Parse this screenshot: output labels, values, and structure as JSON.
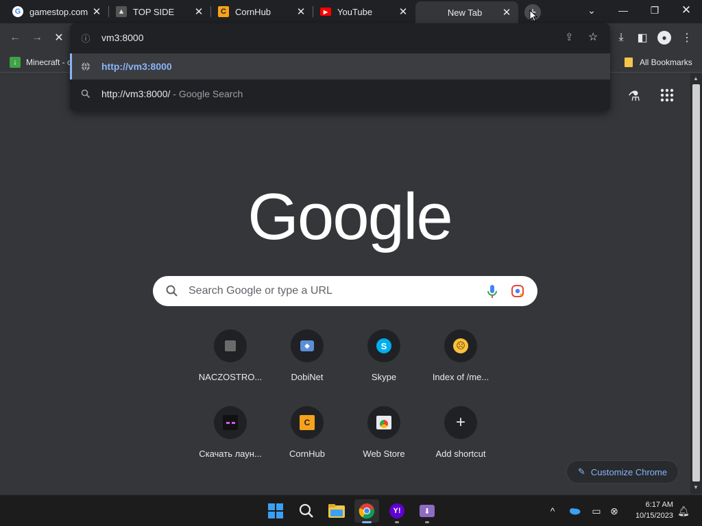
{
  "tabs": [
    {
      "title": "gamestop.com",
      "favicon": "google-g-icon"
    },
    {
      "title": "TOP SIDE",
      "favicon": "topside-icon"
    },
    {
      "title": "CornHub",
      "favicon": "cornhub-ch-icon"
    },
    {
      "title": "YouTube",
      "favicon": "youtube-icon"
    },
    {
      "title": "New Tab",
      "favicon": ""
    }
  ],
  "newtab_label": "+",
  "omnibox": {
    "value": "vm3:8000",
    "suggestions": [
      {
        "url": "http://vm3:8000",
        "icon": "globe-icon"
      },
      {
        "text": "http://vm3:8000/",
        "suffix": " - Google Search",
        "icon": "search-icon"
      }
    ]
  },
  "bookmarks": {
    "first": "Minecraft - c",
    "all": "All Bookmarks"
  },
  "logo": "Google",
  "search": {
    "placeholder": "Search Google or type a URL"
  },
  "shortcuts": [
    {
      "label": "NACZOSTRO...",
      "icon": "naczostro-icon"
    },
    {
      "label": "DobiNet",
      "icon": "dobinet-icon"
    },
    {
      "label": "Skype",
      "icon": "skype-icon"
    },
    {
      "label": "Index of /me...",
      "icon": "emoji-icon"
    },
    {
      "label": "Скачать лаун...",
      "icon": "enderman-icon"
    },
    {
      "label": "CornHub",
      "icon": "cornhub-ch-icon"
    },
    {
      "label": "Web Store",
      "icon": "webstore-icon"
    },
    {
      "label": "Add shortcut",
      "icon": "plus-icon"
    }
  ],
  "customize": "Customize Chrome",
  "clock": {
    "time": "6:17 AM",
    "date": "10/15/2023"
  },
  "colors": {
    "accent": "#8ab4f8",
    "bg": "#35363a",
    "chrome_dark": "#202124",
    "cornhub": "#f7a21b"
  }
}
